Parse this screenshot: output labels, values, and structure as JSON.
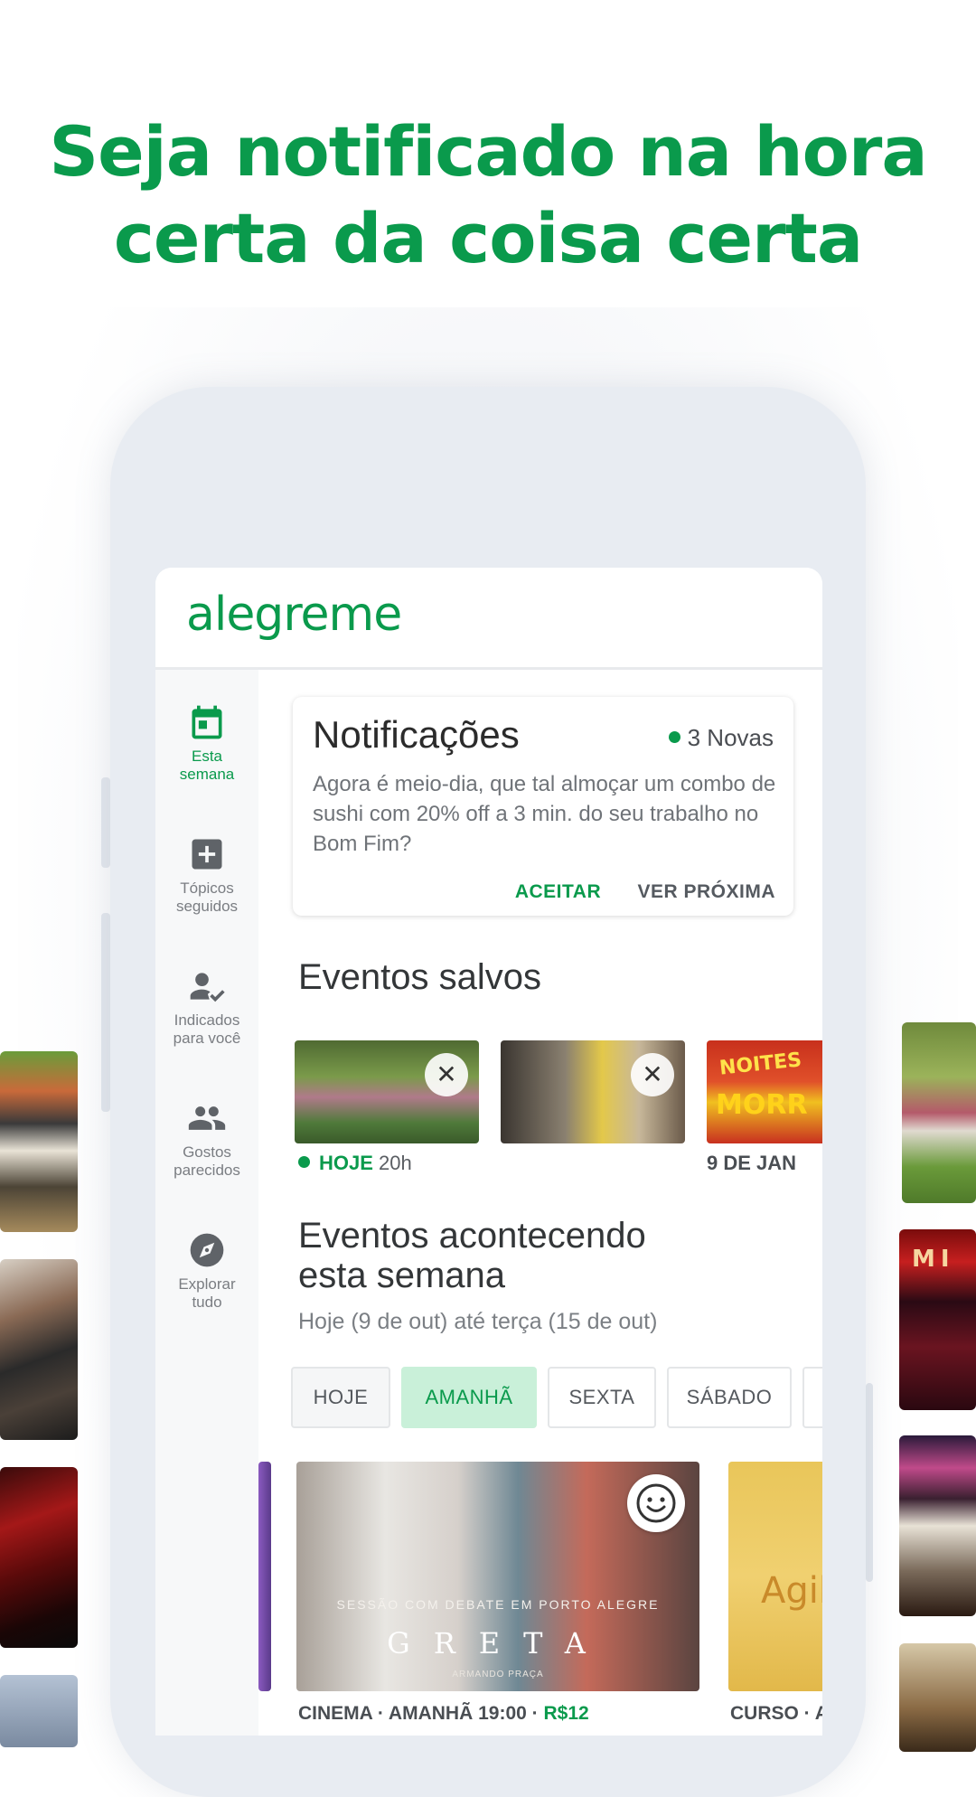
{
  "headline": {
    "line1": "Seja notificado na hora",
    "line2": "certa da coisa certa"
  },
  "app": {
    "logo": "alegreme",
    "brand_color": "#0a9a4c"
  },
  "sidebar": {
    "items": [
      {
        "label_line1": "Esta",
        "label_line2": "semana",
        "icon": "calendar-icon",
        "active": true
      },
      {
        "label_line1": "Tópicos",
        "label_line2": "seguidos",
        "icon": "plus-box-icon",
        "active": false
      },
      {
        "label_line1": "Indicados",
        "label_line2": "para você",
        "icon": "person-check-icon",
        "active": false
      },
      {
        "label_line1": "Gostos",
        "label_line2": "parecidos",
        "icon": "people-icon",
        "active": false
      },
      {
        "label_line1": "Explorar",
        "label_line2": "tudo",
        "icon": "compass-icon",
        "active": false
      }
    ]
  },
  "notification": {
    "title": "Notificações",
    "badge": "3 Novas",
    "body": "Agora é meio-dia, que tal almoçar um combo de sushi com 20% off a 3 min. do seu trabalho no Bom Fim?",
    "accept": "ACEITAR",
    "next": "VER PRÓXIMA"
  },
  "saved_events": {
    "title": "Eventos salvos",
    "date1_bold": "HOJE",
    "date1_rest": "20h",
    "date3": "9 DE JAN",
    "card3_line1": "NOITES",
    "card3_line2": "MORR"
  },
  "week_events": {
    "title_line1": "Eventos acontecendo",
    "title_line2": "esta semana",
    "subtitle": "Hoje (9 de out) até terça (15 de out)",
    "chips": [
      "HOJE",
      "AMANHÃ",
      "SEXTA",
      "SÁBADO"
    ],
    "card1_overlay": "SESSÃO COM DEBATE EM PORTO ALEGRE",
    "card1_title": "GRETA",
    "card1_credit": "ARMANDO PRAÇA",
    "card1_meta": "CINEMA · AMANHÃ 19:00 · ",
    "card1_price": "R$12",
    "card2_title": "Agil",
    "card2_meta": "CURSO · A"
  },
  "side_thumbnails": {
    "right2_sign": "MI"
  }
}
